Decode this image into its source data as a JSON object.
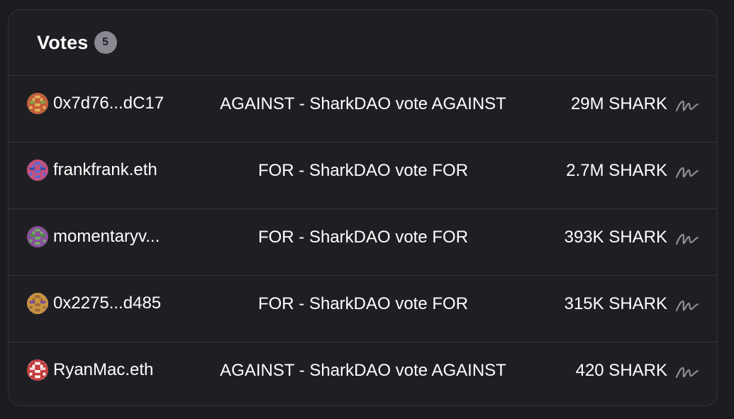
{
  "votes": {
    "title": "Votes",
    "count": "5",
    "rows": [
      {
        "voter": "0x7d76...dC17",
        "reason": "AGAINST - SharkDAO vote AGAINST",
        "amount": "29M SHARK",
        "avatar_colors": [
          "#7fa14a",
          "#c75b3c",
          "#e0b85a"
        ]
      },
      {
        "voter": "frankfrank.eth",
        "reason": "FOR - SharkDAO vote FOR",
        "amount": "2.7M SHARK",
        "avatar_colors": [
          "#3a4fa8",
          "#c9507a",
          "#5a6bd8"
        ]
      },
      {
        "voter": "momentaryv...",
        "reason": "FOR - SharkDAO vote FOR",
        "amount": "393K SHARK",
        "avatar_colors": [
          "#4d8a45",
          "#8a4da0",
          "#6fb25e"
        ]
      },
      {
        "voter": "0x2275...d485",
        "reason": "FOR - SharkDAO vote FOR",
        "amount": "315K SHARK",
        "avatar_colors": [
          "#7a4aa0",
          "#c8963c",
          "#a06a3a"
        ]
      },
      {
        "voter": "RyanMac.eth",
        "reason": "AGAINST - SharkDAO vote AGAINST",
        "amount": "420 SHARK",
        "avatar_colors": [
          "#f3d3dc",
          "#c23a3a",
          "#ffffff"
        ]
      }
    ]
  },
  "icons": {
    "signature": "signature-icon"
  },
  "colors": {
    "background": "#1c1b20",
    "card": "#1f1e23",
    "divider": "#34333a",
    "badge": "#8a8991",
    "signature_icon": "#8f8e96"
  }
}
